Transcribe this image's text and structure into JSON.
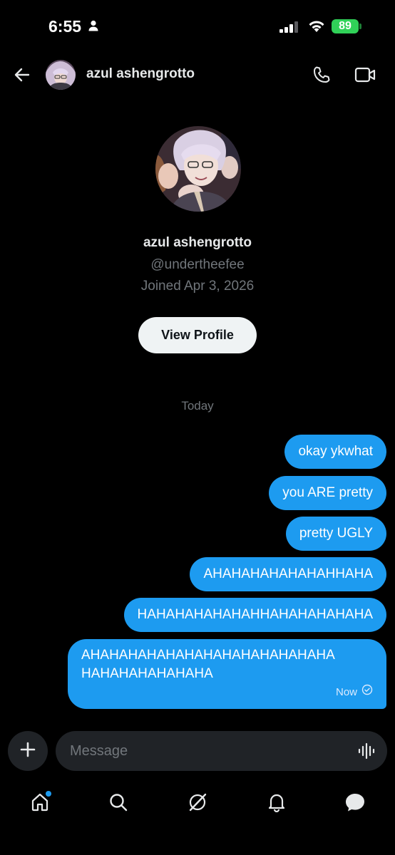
{
  "status_bar": {
    "time": "6:55",
    "battery": "89"
  },
  "header": {
    "name": "azul ashengrotto"
  },
  "profile": {
    "name": "azul ashengrotto",
    "handle": "@undertheefee",
    "joined": "Joined Apr 3, 2026",
    "view_profile_label": "View Profile"
  },
  "conversation": {
    "day_label": "Today",
    "messages": [
      {
        "text": "okay ykwhat"
      },
      {
        "text": "you ARE pretty"
      },
      {
        "text": "pretty UGLY"
      },
      {
        "text": "AHAHAHAHAHAHAHHAHA"
      },
      {
        "text": "HAHAHAHAHAHAHHAHAHAHAHAHA"
      },
      {
        "text": "AHAHAHAHAHAHAHAHAHAHAHAHAHA HAHAHAHAHAHAHA",
        "time": "Now"
      }
    ]
  },
  "composer": {
    "placeholder": "Message"
  },
  "icons": {
    "back": "arrow-left-icon",
    "phone": "phone-icon",
    "video": "video-icon",
    "add": "plus-icon",
    "voice": "waveform-icon",
    "tabs": [
      "home-icon",
      "search-icon",
      "grok-icon",
      "bell-icon",
      "messages-icon"
    ]
  },
  "colors": {
    "accent": "#1d9bf0",
    "background": "#000000",
    "muted": "#71767b",
    "battery": "#30d158"
  }
}
